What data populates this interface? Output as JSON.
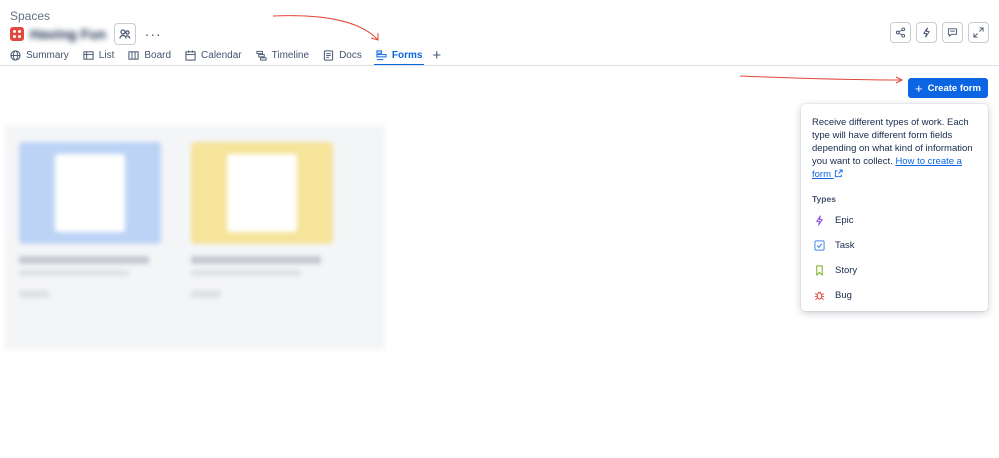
{
  "breadcrumb": "Spaces",
  "space": {
    "name": "Having Fun"
  },
  "tabs": [
    {
      "label": "Summary",
      "icon": "globe-icon"
    },
    {
      "label": "List",
      "icon": "list-icon"
    },
    {
      "label": "Board",
      "icon": "board-icon"
    },
    {
      "label": "Calendar",
      "icon": "calendar-icon"
    },
    {
      "label": "Timeline",
      "icon": "timeline-icon"
    },
    {
      "label": "Docs",
      "icon": "doc-icon"
    },
    {
      "label": "Forms",
      "icon": "forms-icon",
      "active": true
    }
  ],
  "add_tab_label": "+",
  "more_label": "···",
  "create_form": {
    "plus": "+",
    "label": "Create form"
  },
  "popover": {
    "description": "Receive different types of work. Each type will have different form fields depending on what kind of information you want to collect.",
    "link": "How to create a form",
    "types_label": "Types",
    "types": [
      {
        "label": "Epic",
        "icon": "lightning-icon",
        "color": "#904ee2"
      },
      {
        "label": "Task",
        "icon": "checkbox-icon",
        "color": "#4688ec"
      },
      {
        "label": "Story",
        "icon": "bookmark-icon",
        "color": "#82b536"
      },
      {
        "label": "Bug",
        "icon": "bug-icon",
        "color": "#e2483d"
      }
    ]
  },
  "colors": {
    "accent": "#0c66e4",
    "card_blue": "#bcd3f6",
    "card_yellow": "#f5e49a",
    "annotation": "#e2483d"
  }
}
